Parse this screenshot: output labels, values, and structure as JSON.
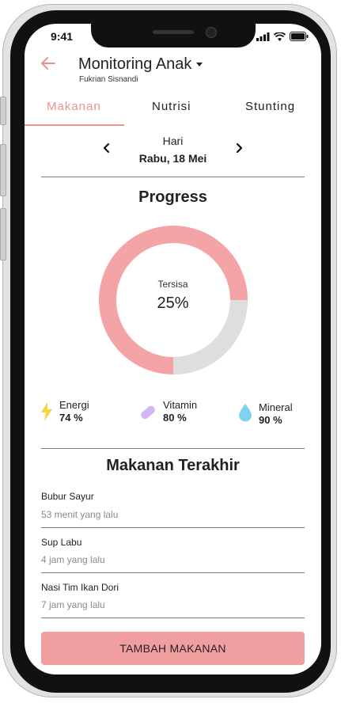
{
  "status_bar": {
    "time": "9:41"
  },
  "header": {
    "title": "Monitoring Anak",
    "subtitle": "Fukrian Sisnandi"
  },
  "tabs": [
    {
      "label": "Makanan",
      "active": true
    },
    {
      "label": "Nutrisi",
      "active": false
    },
    {
      "label": "Stunting",
      "active": false
    }
  ],
  "date_nav": {
    "day_label": "Hari",
    "date": "Rabu, 18 Mei"
  },
  "progress": {
    "title": "Progress",
    "caption": "Tersisa",
    "value_label": "25%",
    "remaining_fraction": 0.25,
    "colors": {
      "consumed": "#f4a3a6",
      "remaining": "#dedede"
    }
  },
  "nutrients": [
    {
      "name": "Energi",
      "value": "74 %",
      "icon": "lightning-icon",
      "color": "#f7d33f"
    },
    {
      "name": "Vitamin",
      "value": "80 %",
      "icon": "pill-icon",
      "color": "#d5b6f3"
    },
    {
      "name": "Mineral",
      "value": "90 %",
      "icon": "water-drop-icon",
      "color": "#7fd3f0"
    }
  ],
  "recent_meals": {
    "title": "Makanan Terakhir",
    "items": [
      {
        "name": "Bubur Sayur",
        "time": "53 menit yang lalu"
      },
      {
        "name": "Sup Labu",
        "time": "4 jam yang lalu"
      },
      {
        "name": "Nasi Tim Ikan Dori",
        "time": "7 jam yang lalu"
      }
    ]
  },
  "add_button": {
    "label": "TAMBAH MAKANAN",
    "color": "#f19ea0"
  },
  "accent_color": "#f0928f"
}
